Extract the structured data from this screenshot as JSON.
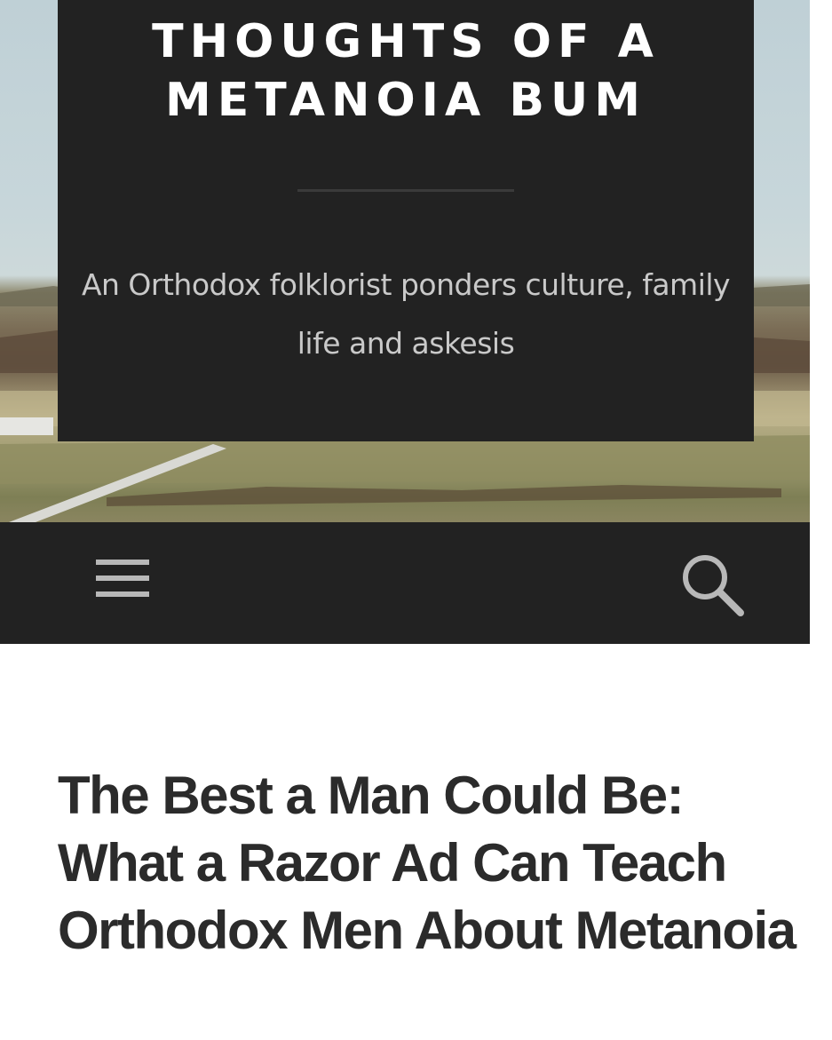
{
  "site": {
    "title": "THOUGHTS OF A METANOIA BUM",
    "tagline": "An Orthodox folklorist ponders culture, family life and askesis"
  },
  "navbar": {
    "menu_icon": "hamburger-menu-icon",
    "search_icon": "search-icon"
  },
  "post": {
    "title": "The Best a Man Could Be: What a Razor Ad Can Teach Orthodox Men About Metanoia"
  },
  "colors": {
    "header_box": "#222222",
    "navbar": "#222222",
    "title_text": "#ffffff",
    "tagline_text": "#c9c9c9",
    "post_title_text": "#2b2b2b",
    "icon": "#b8b8b8"
  }
}
